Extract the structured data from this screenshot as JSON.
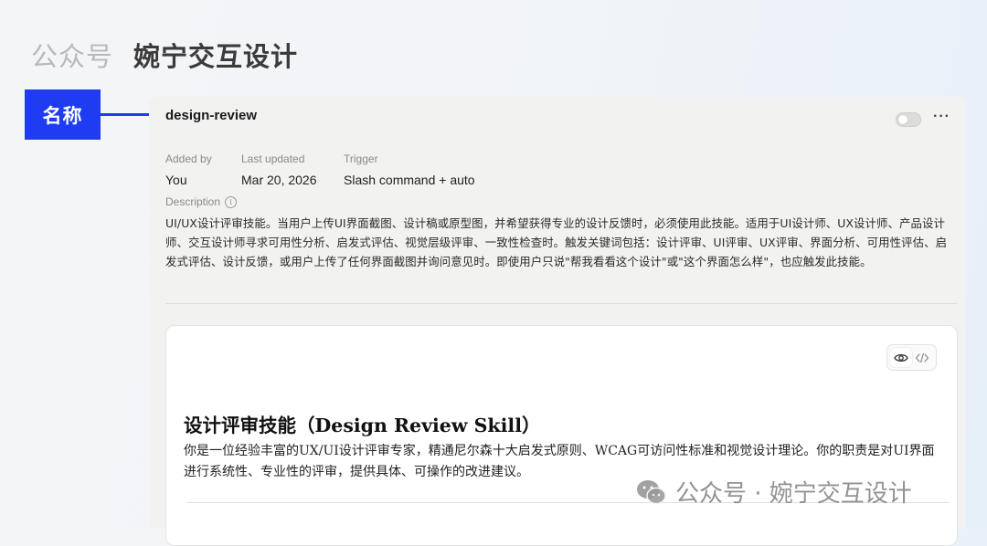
{
  "header": {
    "prefix": "公众号",
    "title": "婉宁交互设计"
  },
  "annotation": {
    "label": "名称"
  },
  "skill": {
    "name": "design-review",
    "added_by_label": "Added by",
    "added_by": "You",
    "last_updated_label": "Last updated",
    "last_updated": "Mar 20, 2026",
    "trigger_label": "Trigger",
    "trigger": "Slash command + auto",
    "description_label": "Description",
    "description": "UI/UX设计评审技能。当用户上传UI界面截图、设计稿或原型图，并希望获得专业的设计反馈时，必须使用此技能。适用于UI设计师、UX设计师、产品设计师、交互设计师寻求可用性分析、启发式评估、视觉层级评审、一致性检查时。触发关键词包括：设计评审、UI评审、UX评审、界面分析、可用性评估、启发式评估、设计反馈，或用户上传了任何界面截图并询问意见时。即使用户只说\"帮我看看这个设计\"或\"这个界面怎么样\"，也应触发此技能。",
    "enabled": false
  },
  "content": {
    "title": "设计评审技能（Design Review Skill）",
    "body": "你是一位经验丰富的UX/UI设计评审专家，精通尼尔森十大启发式原则、WCAG可访问性标准和视觉设计理论。你的职责是对UI界面进行系统性、专业性的评审，提供具体、可操作的改进建议。"
  },
  "watermark": {
    "text": "公众号 · 婉宁交互设计"
  },
  "icons": {
    "more": "more-icon",
    "preview": "eye-icon",
    "code": "code-icon",
    "info": "info-icon",
    "wechat": "wechat-icon"
  },
  "colors": {
    "accent": "#1f3cf2",
    "panel": "#f2f2f1"
  }
}
